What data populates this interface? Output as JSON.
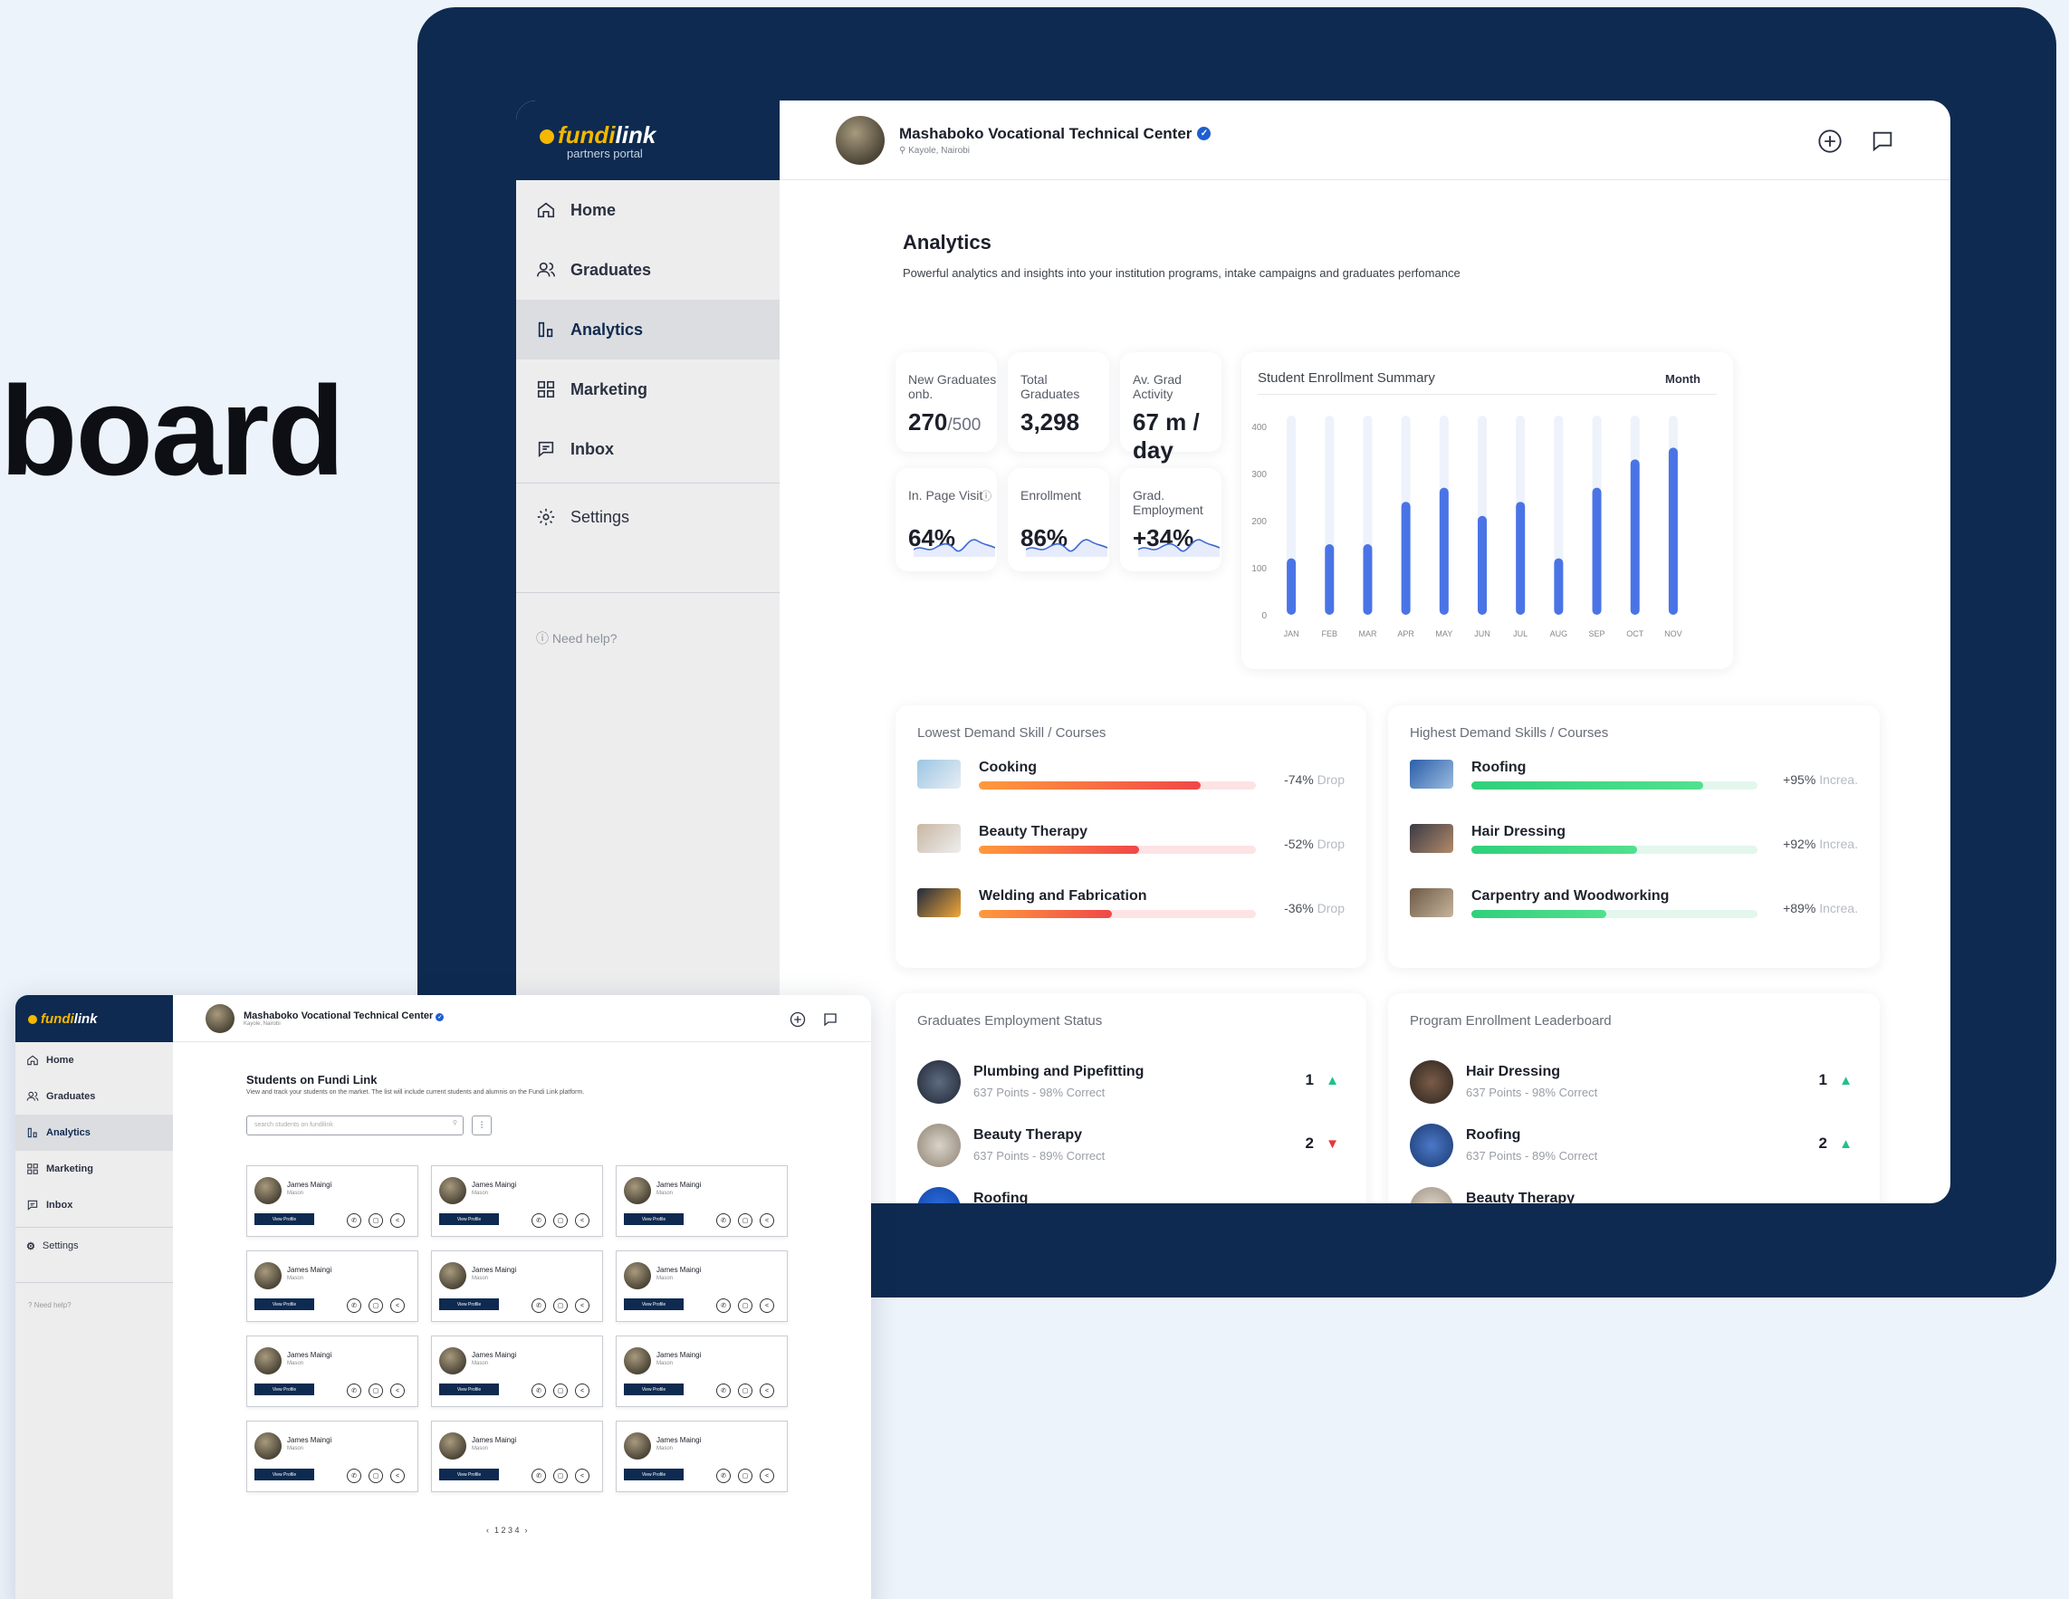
{
  "hero_text": "board",
  "brand": {
    "name_a": "fundi",
    "name_b": "link",
    "tagline": "partners portal"
  },
  "institution": {
    "name": "Mashaboko Vocational Technical Center",
    "location": "Kayole, Nairobi"
  },
  "nav": {
    "items": [
      {
        "label": "Home",
        "icon": "home-icon"
      },
      {
        "label": "Graduates",
        "icon": "users-icon"
      },
      {
        "label": "Analytics",
        "icon": "bar-chart-icon",
        "active": true
      },
      {
        "label": "Marketing",
        "icon": "grid-icon"
      },
      {
        "label": "Inbox",
        "icon": "message-icon"
      }
    ],
    "settings": "Settings",
    "help": "Need help?"
  },
  "analytics": {
    "title": "Analytics",
    "subtitle": "Powerful analytics and insights into your institution programs, intake campaigns and graduates perfomance",
    "kpis": [
      {
        "label": "New Graduates onb.",
        "value": "270",
        "suffix": "/500"
      },
      {
        "label": "Total Graduates",
        "value": "3,298"
      },
      {
        "label": "Av. Grad Activity",
        "value": "67 m / day"
      },
      {
        "label": "In. Page Visit",
        "value": "64%"
      },
      {
        "label": "Enrollment",
        "value": "86%"
      },
      {
        "label": "Grad. Employment",
        "value": "+34%"
      }
    ],
    "lowest": {
      "title": "Lowest Demand Skill / Courses",
      "items": [
        {
          "name": "Cooking",
          "value": "-74%",
          "unit": "Drop",
          "fill": 0.8
        },
        {
          "name": "Beauty Therapy",
          "value": "-52%",
          "unit": "Drop",
          "fill": 0.58
        },
        {
          "name": "Welding and Fabrication",
          "value": "-36%",
          "unit": "Drop",
          "fill": 0.48
        }
      ]
    },
    "highest": {
      "title": "Highest Demand Skills / Courses",
      "items": [
        {
          "name": "Roofing",
          "value": "+95%",
          "unit": "Increa.",
          "fill": 0.81
        },
        {
          "name": "Hair Dressing",
          "value": "+92%",
          "unit": "Increa.",
          "fill": 0.58
        },
        {
          "name": "Carpentry and Woodworking",
          "value": "+89%",
          "unit": "Increa.",
          "fill": 0.47
        }
      ]
    },
    "employment": {
      "title": "Graduates Employment Status",
      "items": [
        {
          "name": "Plumbing and Pipefitting",
          "meta": "637 Points - 98% Correct",
          "rank": "1",
          "trend": "▲"
        },
        {
          "name": "Beauty Therapy",
          "meta": "637 Points - 89% Correct",
          "rank": "2",
          "trend": "▼"
        },
        {
          "name": "Roofing",
          "meta": "",
          "rank": "",
          "trend": ""
        }
      ]
    },
    "leaderboard": {
      "title": "Program Enrollment Leaderboard",
      "items": [
        {
          "name": "Hair Dressing",
          "meta": "637 Points - 98% Correct",
          "rank": "1",
          "trend": "▲"
        },
        {
          "name": "Roofing",
          "meta": "637 Points - 89% Correct",
          "rank": "2",
          "trend": "▲"
        },
        {
          "name": "Beauty Therapy",
          "meta": "",
          "rank": "",
          "trend": ""
        }
      ]
    }
  },
  "chart_data": {
    "type": "bar",
    "title": "Student Enrollment Summary",
    "period": "Month",
    "categories": [
      "JAN",
      "FEB",
      "MAR",
      "APR",
      "MAY",
      "JUN",
      "JUL",
      "AUG",
      "SEP",
      "OCT",
      "NOV"
    ],
    "values": [
      120,
      150,
      150,
      240,
      270,
      210,
      240,
      120,
      270,
      330,
      355
    ],
    "yticks": [
      400,
      300,
      200,
      100,
      0
    ],
    "ylim": [
      0,
      400
    ],
    "color": "#4a74e6"
  },
  "students": {
    "title": "Students on Fundi Link",
    "subtitle": "View and track your students on the market. The list will include current students and alumnis on the Fundi Link platform.",
    "search_placeholder": "search students on fundilink",
    "card_name": "James Maingi",
    "card_role": "Mason",
    "view_label": "View Profile",
    "pager": [
      "‹",
      "1 2 3 4",
      "›"
    ]
  }
}
